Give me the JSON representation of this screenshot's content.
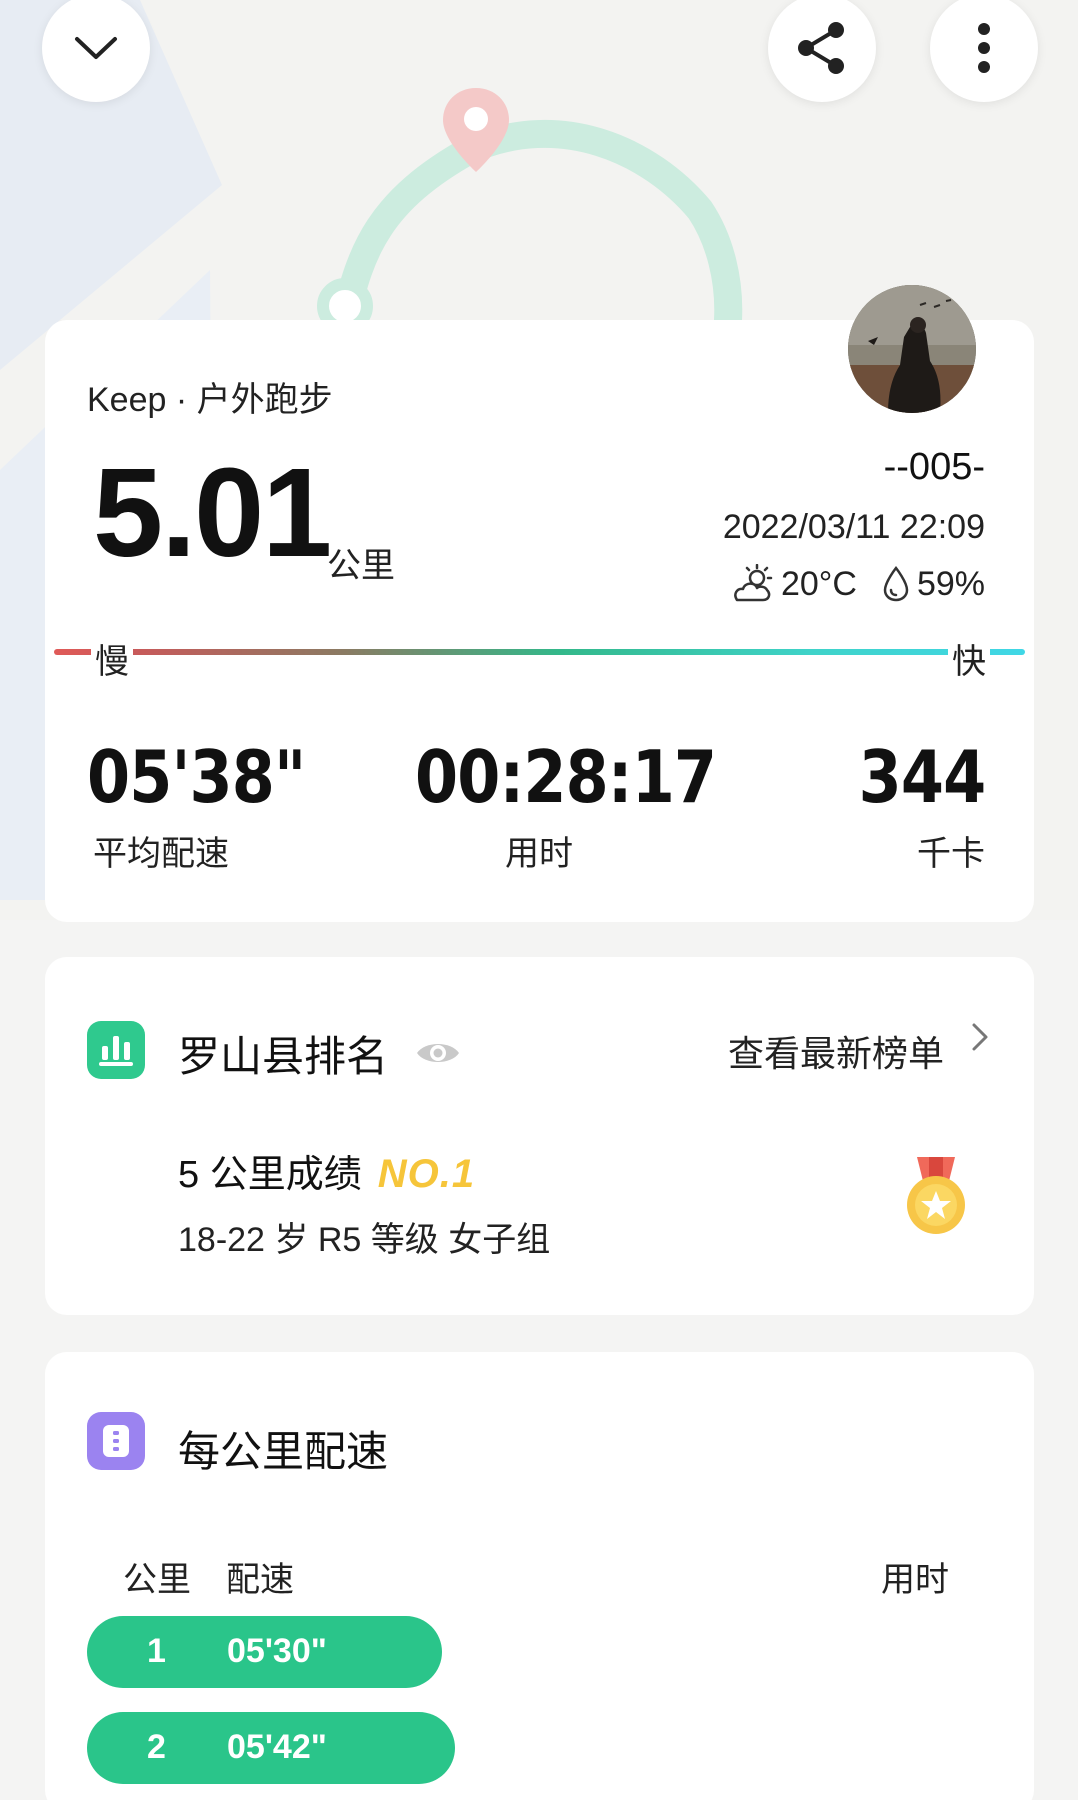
{
  "header": {
    "collapse_icon": "chevron-down-icon",
    "share_icon": "share-icon",
    "more_icon": "more-vertical-icon"
  },
  "summary": {
    "source": "Keep · 户外跑步",
    "distance": "5.01",
    "distance_unit": "公里",
    "username": "--005-",
    "datetime": "2022/03/11 22:09",
    "temperature": "20°C",
    "humidity": "59%",
    "slow_label": "慢",
    "fast_label": "快",
    "stats": [
      {
        "value": "05'38\"",
        "label": "平均配速"
      },
      {
        "value": "00:28:17",
        "label": "用时"
      },
      {
        "value": "344",
        "label": "千卡"
      }
    ]
  },
  "ranking": {
    "title": "罗山县排名",
    "link": "查看最新榜单",
    "result_label": "5 公里成绩",
    "rank": "NO.1",
    "group": "18-22 岁 R5 等级 女子组"
  },
  "pace": {
    "title": "每公里配速",
    "col_km": "公里",
    "col_pace": "配速",
    "col_time": "用时",
    "splits": [
      {
        "km": "1",
        "pace": "05'30\"",
        "fraction": 0.53
      },
      {
        "km": "2",
        "pace": "05'42\"",
        "fraction": 0.55
      }
    ]
  },
  "colors": {
    "accent_green": "#2ac58a",
    "rank_gold": "#f6c53a",
    "rank_icon": "#2fc98e",
    "pace_icon": "#9b83f0"
  }
}
